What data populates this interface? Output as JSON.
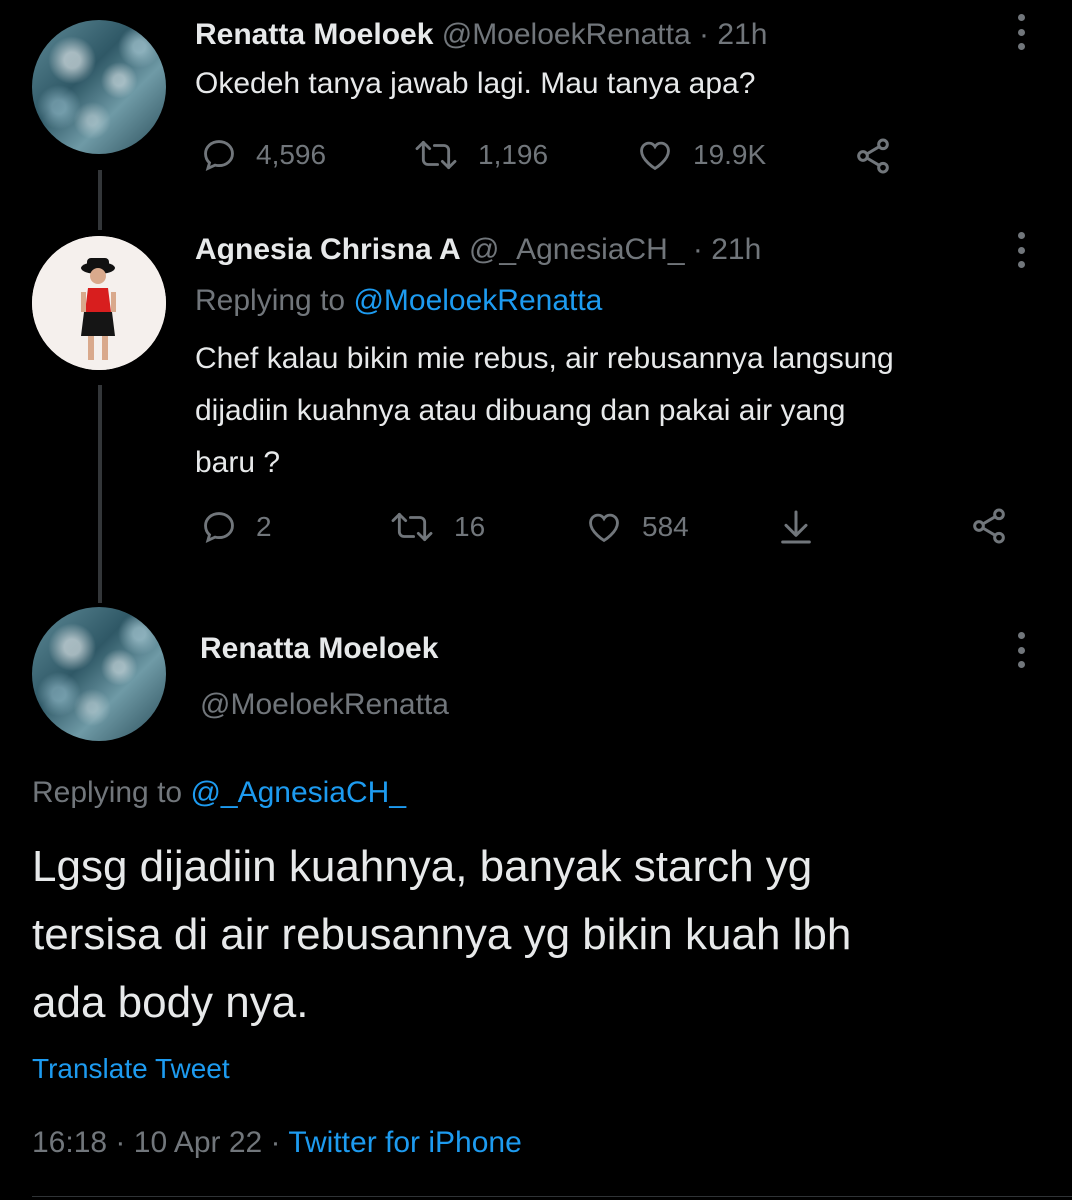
{
  "tweet1": {
    "name": "Renatta Moeloek",
    "handle": "@MoeloekRenatta",
    "time": "21h",
    "text": "Okedeh tanya jawab lagi. Mau tanya apa?",
    "replies": "4,596",
    "retweets": "1,196",
    "likes": "19.9K"
  },
  "tweet2": {
    "name": "Agnesia Chrisna A",
    "handle": "@_AgnesiaCH_",
    "time": "21h",
    "replying_prefix": "Replying to",
    "replying_handle": "@MoeloekRenatta",
    "text_lines": [
      "Chef kalau bikin mie rebus, air rebusannya langsung",
      "dijadiin kuahnya atau dibuang dan pakai air yang",
      "baru ?"
    ],
    "replies": "2",
    "retweets": "16",
    "likes": "584"
  },
  "tweet3": {
    "name": "Renatta Moeloek",
    "handle": "@MoeloekRenatta",
    "replying_prefix": "Replying to",
    "replying_handle": "@_AgnesiaCH_",
    "text_lines": [
      "Lgsg dijadiin kuahnya, banyak starch yg",
      "tersisa di air rebusannya yg bikin kuah lbh",
      "ada body nya."
    ],
    "translate": "Translate Tweet",
    "time": "16:18",
    "date": "10 Apr 22",
    "source": "Twitter for iPhone"
  },
  "sep": "·",
  "colors": {
    "background": "#000000",
    "text": "#e7e9ea",
    "muted": "#71767b",
    "accent": "#1d9bf0",
    "thread_line": "#333639"
  },
  "icons": [
    "reply-icon",
    "retweet-icon",
    "like-icon",
    "share-icon",
    "download-icon",
    "more-icon"
  ]
}
